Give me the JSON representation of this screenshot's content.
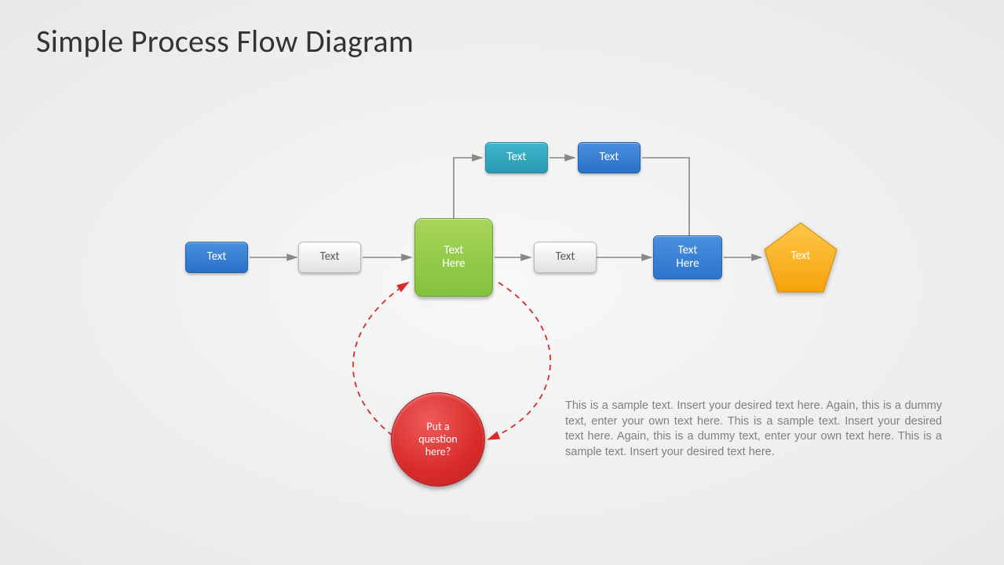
{
  "title": "Simple Process Flow Diagram",
  "shapes": {
    "main_blue1": "Text",
    "main_gray1": "Text",
    "main_green": "Text\nHere",
    "main_gray2": "Text",
    "main_blue2": "Text\nHere",
    "main_pentagon": "Text",
    "top_teal": "Text",
    "top_blue": "Text",
    "circle_red": "Put a\nquestion\nhere?"
  },
  "paragraph": "This is a sample text. Insert your desired text here. Again, this is a dummy text, enter your own text here. This is a sample text. Insert your desired text here. Again, this is a dummy text, enter your own text here. This is a sample text. Insert your desired text here."
}
